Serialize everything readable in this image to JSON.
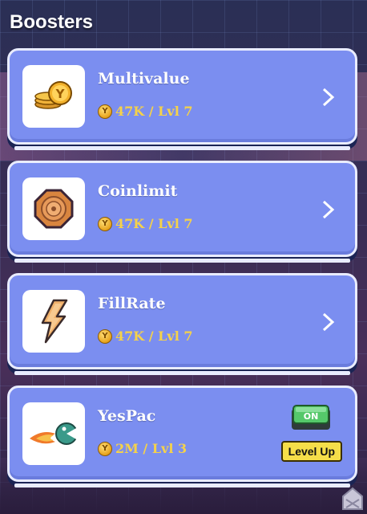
{
  "header": {
    "title": "Boosters"
  },
  "boosters": [
    {
      "name": "Multivalue",
      "price": "47K / Lvl 7",
      "icon": "coin-stack-icon"
    },
    {
      "name": "Coinlimit",
      "price": "47K / Lvl 7",
      "icon": "target-coin-icon"
    },
    {
      "name": "FillRate",
      "price": "47K / Lvl 7",
      "icon": "lightning-icon"
    },
    {
      "name": "YesPac",
      "price": "2M / Lvl 3",
      "icon": "yespac-creature-icon",
      "toggle_label": "ON",
      "level_up_label": "Level Up"
    }
  ],
  "coin_symbol": "Y",
  "colors": {
    "card_bg": "#7b8ef0",
    "price": "#f5d24a",
    "level_up_bg": "#f5de49",
    "toggle_on": "#4cc35a"
  }
}
